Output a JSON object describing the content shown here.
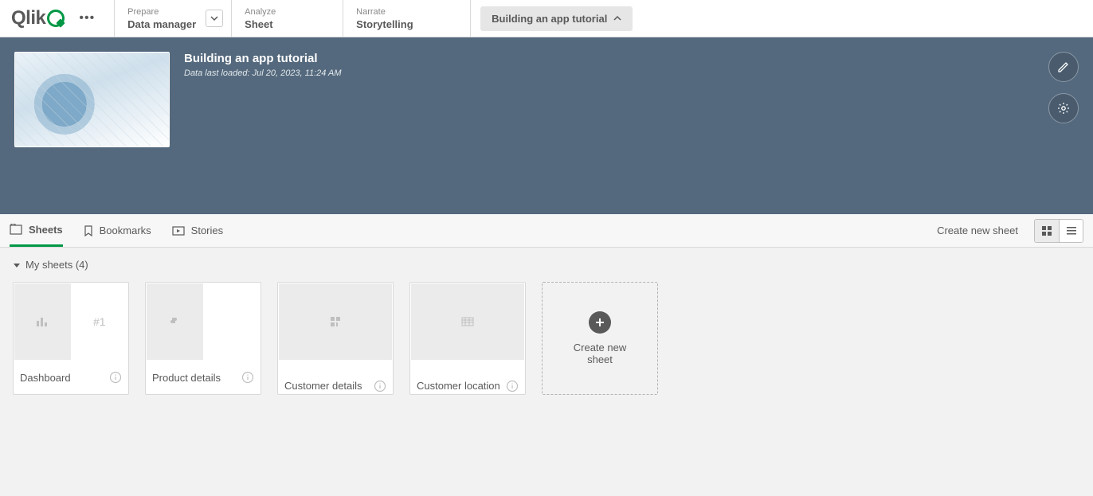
{
  "nav": {
    "prepare_label": "Prepare",
    "prepare_value": "Data manager",
    "analyze_label": "Analyze",
    "analyze_value": "Sheet",
    "narrate_label": "Narrate",
    "narrate_value": "Storytelling",
    "app_button": "Building an app tutorial"
  },
  "hero": {
    "title": "Building an app tutorial",
    "subtitle": "Data last loaded: Jul 20, 2023, 11:24 AM"
  },
  "tabs": {
    "sheets": "Sheets",
    "bookmarks": "Bookmarks",
    "stories": "Stories"
  },
  "toolbar": {
    "create_sheet": "Create new sheet"
  },
  "section": {
    "title": "My sheets (4)"
  },
  "cards": [
    {
      "title": "Dashboard"
    },
    {
      "title": "Product details"
    },
    {
      "title": "Customer details"
    },
    {
      "title": "Customer location"
    }
  ],
  "card_new": {
    "label": "Create new sheet"
  },
  "dashboard_preview_text": "#1"
}
